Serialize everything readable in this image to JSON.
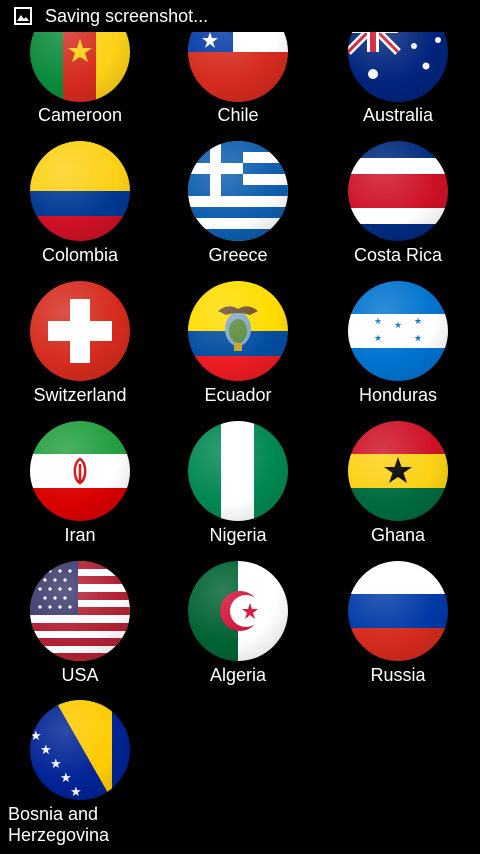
{
  "status_bar": {
    "text": "Saving screenshot..."
  },
  "countries": [
    {
      "name": "Cameroon"
    },
    {
      "name": "Chile"
    },
    {
      "name": "Australia"
    },
    {
      "name": "Colombia"
    },
    {
      "name": "Greece"
    },
    {
      "name": "Costa Rica"
    },
    {
      "name": "Switzerland"
    },
    {
      "name": "Ecuador"
    },
    {
      "name": "Honduras"
    },
    {
      "name": "Iran"
    },
    {
      "name": "Nigeria"
    },
    {
      "name": "Ghana"
    },
    {
      "name": "USA"
    },
    {
      "name": "Algeria"
    },
    {
      "name": "Russia"
    },
    {
      "name": "Bosnia and Herzegovina"
    }
  ],
  "colors": {
    "background": "#000000",
    "text": "#ffffff"
  }
}
